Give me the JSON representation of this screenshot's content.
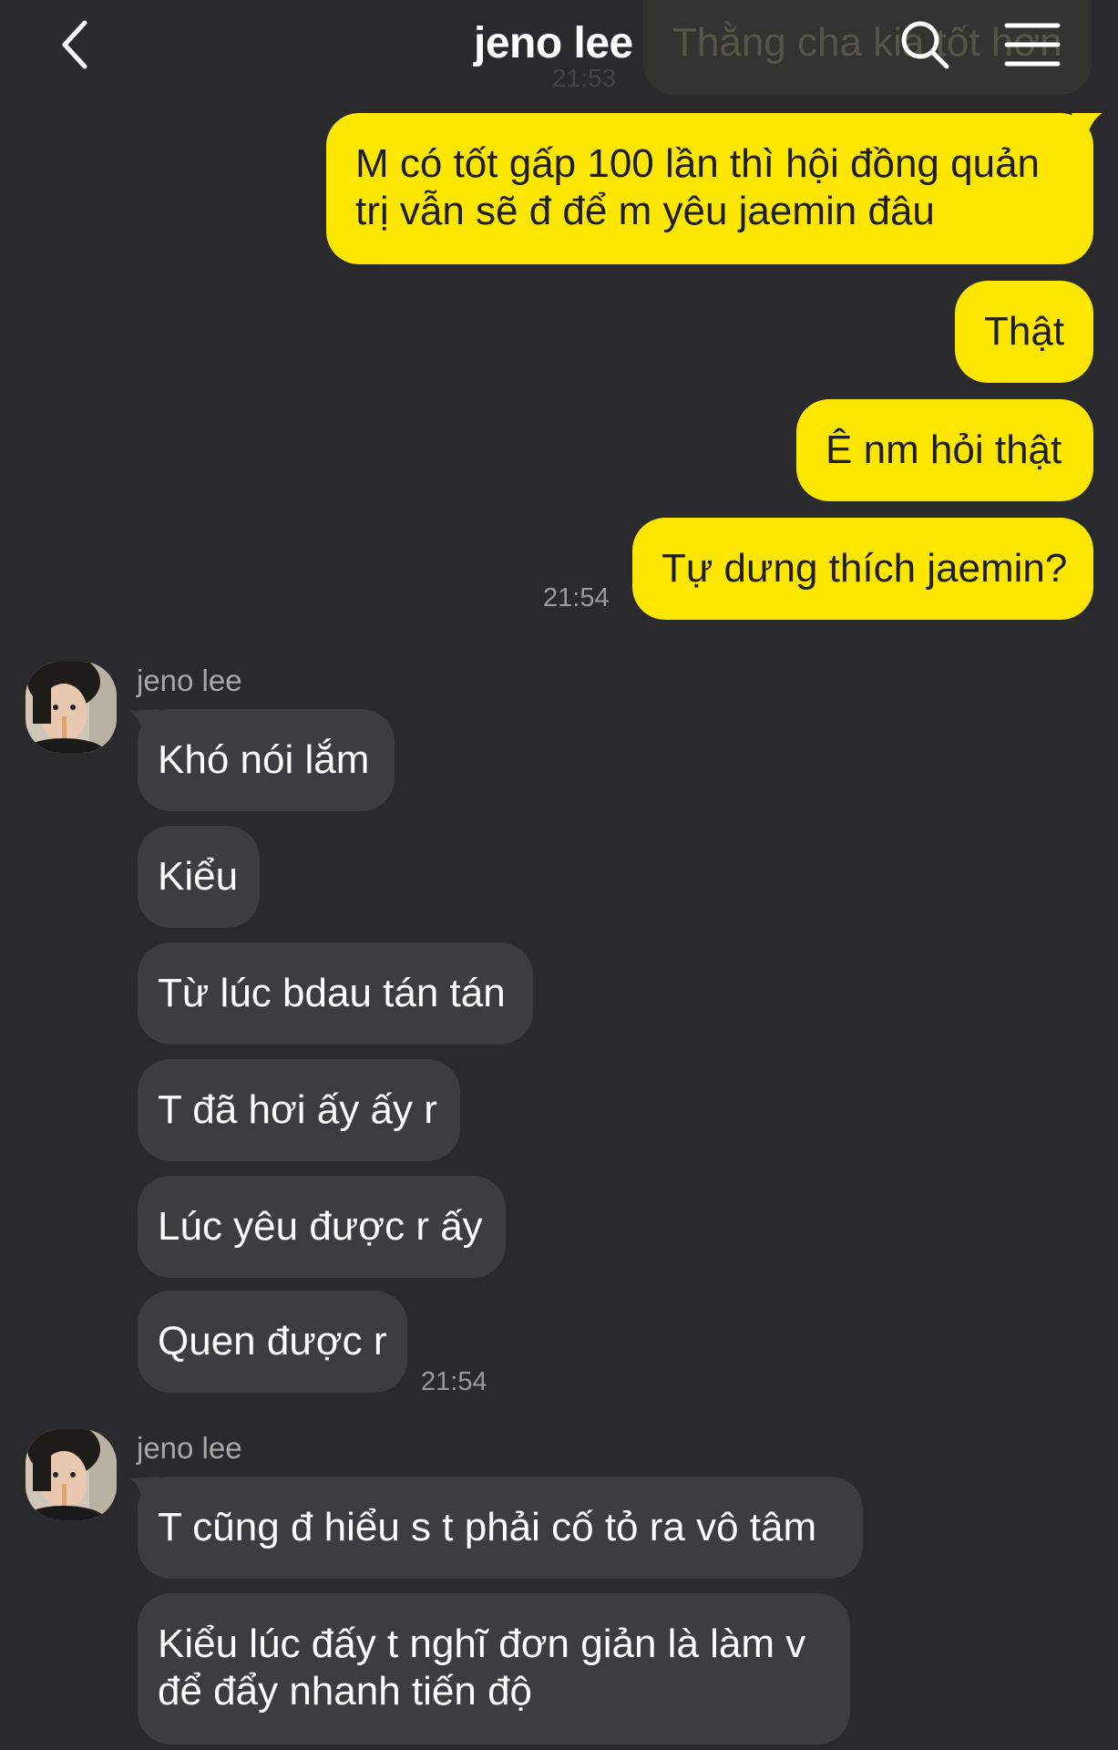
{
  "header": {
    "title": "jeno lee",
    "back_icon": "chevron-left-icon",
    "search_icon": "search-icon",
    "menu_icon": "menu-icon"
  },
  "previous_message": {
    "text": "Thằng cha kia tốt hơn",
    "time": "21:53"
  },
  "colors": {
    "background": "#2a2a2c",
    "my_bubble": "#fde600",
    "their_bubble": "#3d3d3f"
  },
  "my_messages": [
    {
      "lines": [
        "M có tốt gấp 100 lần thì hội đồng quản",
        "trị vẫn sẽ đ để m yêu jaemin đâu"
      ]
    },
    {
      "lines": [
        "Thật"
      ]
    },
    {
      "lines": [
        "Ê nm hỏi thật"
      ]
    },
    {
      "lines": [
        "Tự dưng thích jaemin?"
      ],
      "time": "21:54"
    }
  ],
  "their_groups": [
    {
      "sender": "jeno lee",
      "time": "21:54",
      "messages": [
        {
          "lines": [
            "Khó nói lắm"
          ]
        },
        {
          "lines": [
            "Kiểu"
          ]
        },
        {
          "lines": [
            "Từ lúc bdau tán tán"
          ]
        },
        {
          "lines": [
            "T đã hơi ấy ấy r"
          ]
        },
        {
          "lines": [
            "Lúc yêu được r ấy"
          ]
        },
        {
          "lines": [
            "Quen được r"
          ]
        }
      ]
    },
    {
      "sender": "jeno lee",
      "messages": [
        {
          "lines": [
            "T cũng đ hiểu s t phải cố tỏ ra vô tâm"
          ]
        },
        {
          "lines": [
            "Kiểu lúc đấy t nghĩ đơn giản là làm v",
            "để đẩy nhanh tiến độ"
          ]
        }
      ]
    }
  ]
}
